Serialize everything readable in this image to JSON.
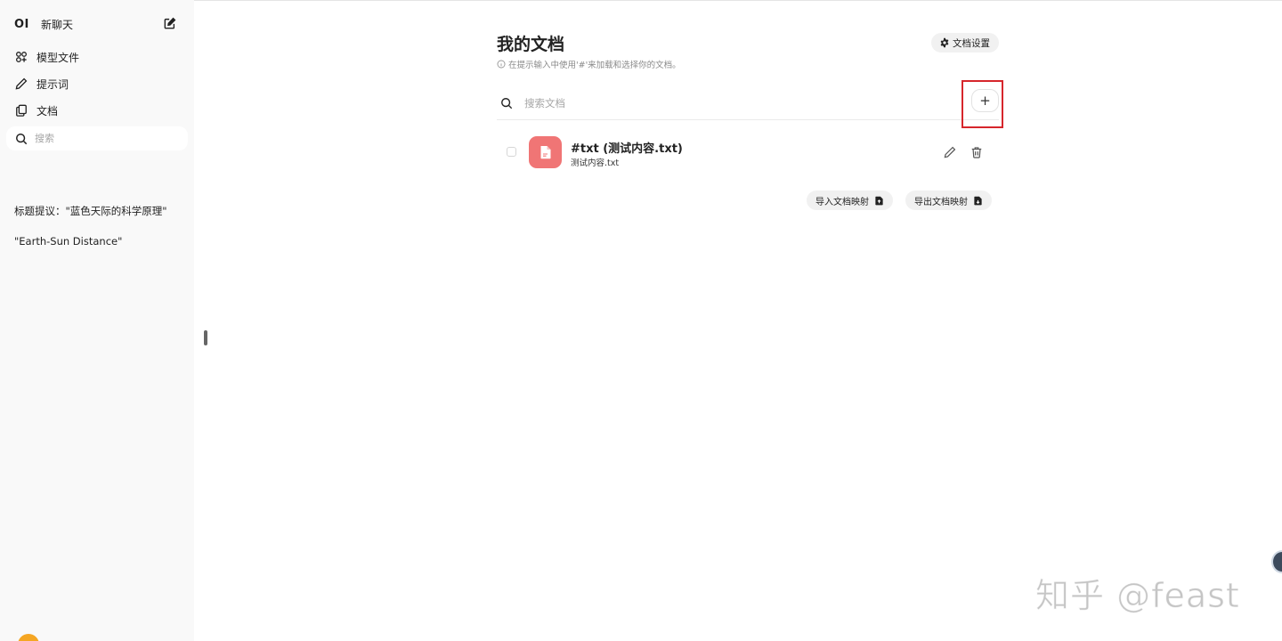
{
  "sidebar": {
    "logo": "OI",
    "new_chat": "新聊天",
    "nav": [
      {
        "label": "模型文件",
        "icon": "models-icon"
      },
      {
        "label": "提示词",
        "icon": "pencil-icon"
      },
      {
        "label": "文档",
        "icon": "documents-icon"
      }
    ],
    "search_placeholder": "搜索",
    "chats": [
      "标题提议：\"蓝色天际的科学原理\"",
      "\"Earth-Sun Distance\""
    ]
  },
  "main": {
    "title": "我的文档",
    "settings_label": "文档设置",
    "hint": "在提示输入中使用'#'来加载和选择你的文档。",
    "search_placeholder": "搜索文档",
    "add_label": "+",
    "documents": [
      {
        "title": "#txt (测试内容.txt)",
        "filename": "测试内容.txt"
      }
    ],
    "import_label": "导入文档映射",
    "export_label": "导出文档映射"
  },
  "watermark": "知乎 @feast",
  "colors": {
    "sidebar_bg": "#f9f9f9",
    "doc_icon_bg": "#f07575",
    "highlight": "#d6262c",
    "avatar": "#f5a623"
  }
}
